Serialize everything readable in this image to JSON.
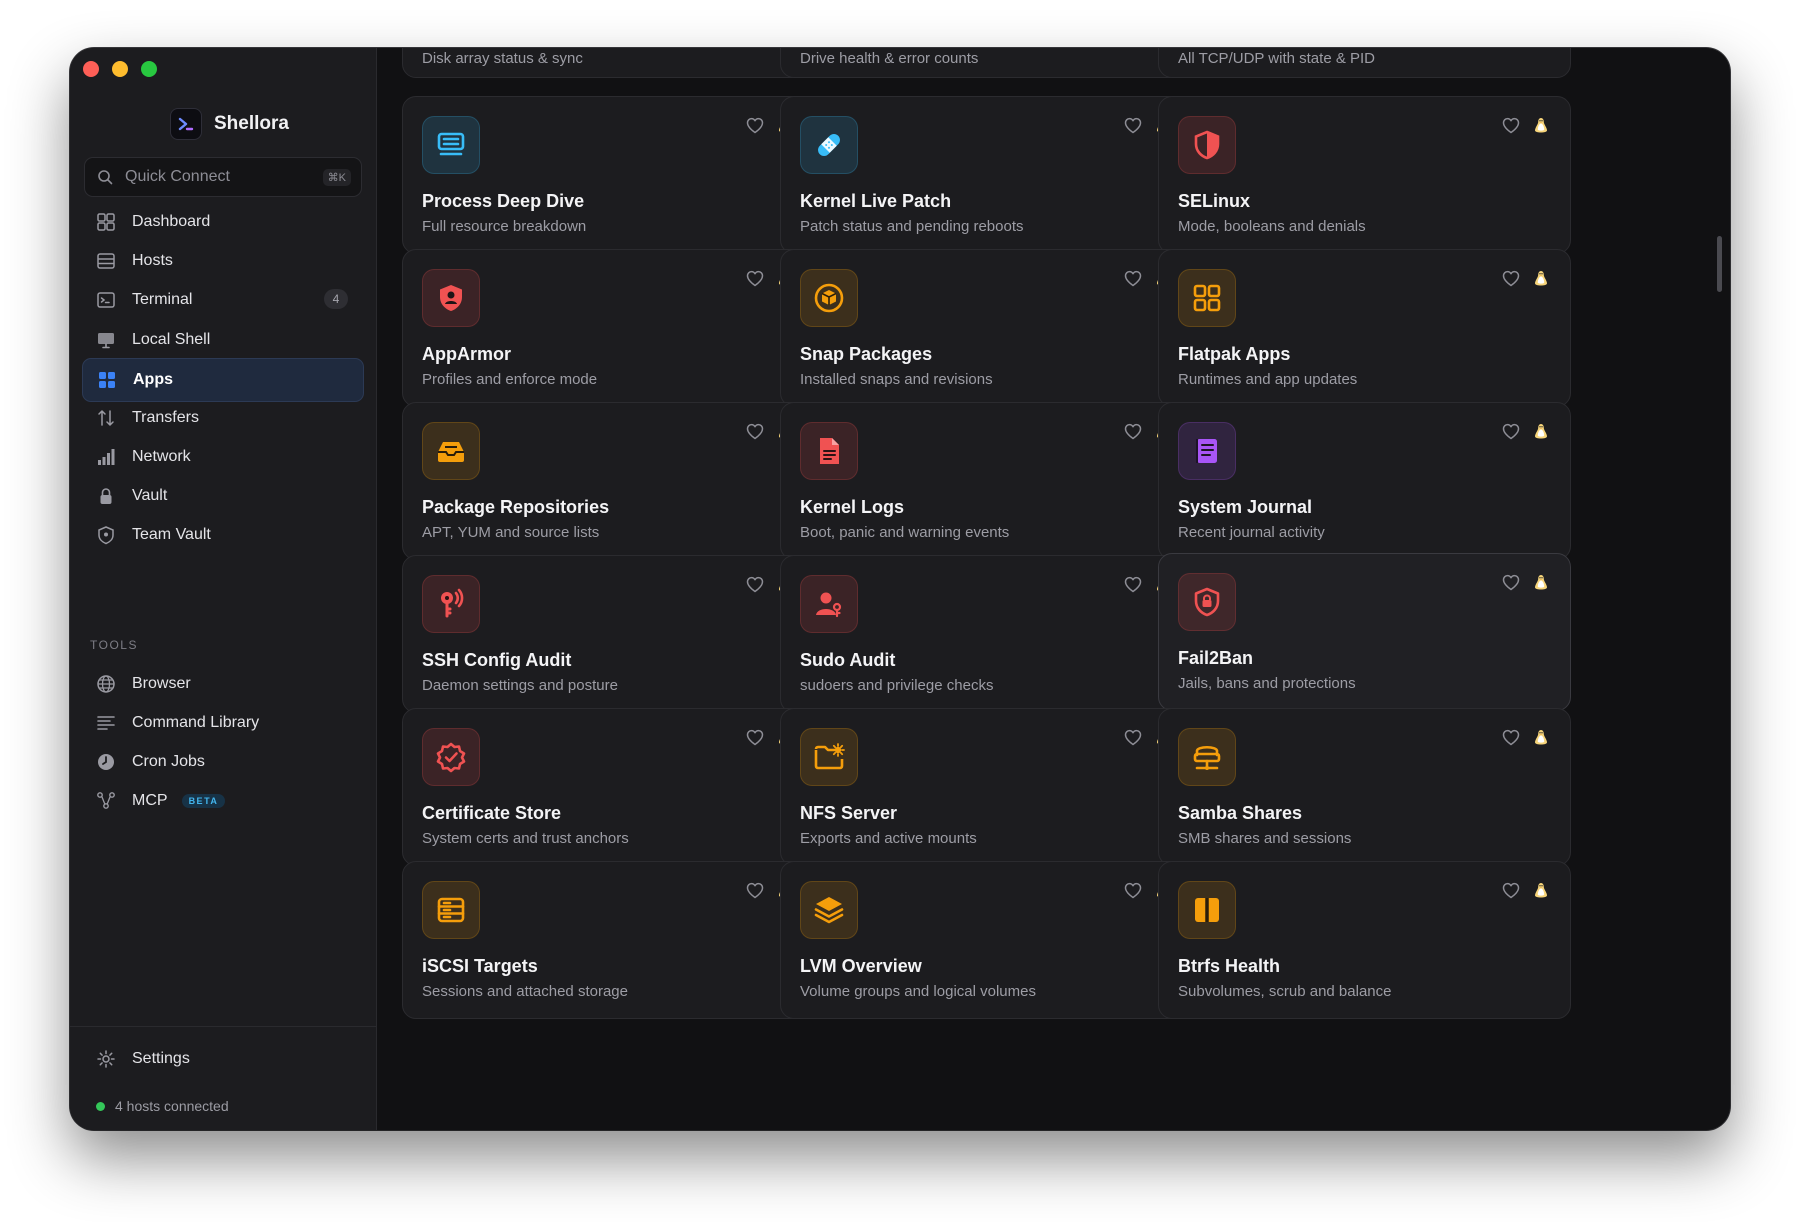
{
  "app": {
    "name": "Shellora"
  },
  "search": {
    "placeholder": "Quick Connect",
    "shortcut": "⌘K"
  },
  "nav": [
    {
      "label": "Dashboard",
      "icon": "dashboard-icon"
    },
    {
      "label": "Hosts",
      "icon": "hosts-icon"
    },
    {
      "label": "Terminal",
      "icon": "terminal-icon",
      "badge": "4"
    },
    {
      "label": "Local Shell",
      "icon": "monitor-icon"
    },
    {
      "label": "Apps",
      "icon": "apps-grid-icon",
      "active": true
    },
    {
      "label": "Transfers",
      "icon": "transfers-icon"
    },
    {
      "label": "Network",
      "icon": "network-bars-icon"
    },
    {
      "label": "Vault",
      "icon": "lock-icon"
    },
    {
      "label": "Team Vault",
      "icon": "shield-icon"
    }
  ],
  "tools": {
    "label": "TOOLS",
    "items": [
      {
        "label": "Browser",
        "icon": "globe-icon"
      },
      {
        "label": "Command Library",
        "icon": "list-icon"
      },
      {
        "label": "Cron Jobs",
        "icon": "clock-icon"
      },
      {
        "label": "MCP",
        "icon": "mcp-nodes-icon",
        "badge": "BETA"
      }
    ]
  },
  "footer": {
    "settings_label": "Settings",
    "status_text": "4 hosts connected",
    "status_color": "#34c759"
  },
  "partial_row": [
    "Disk array status & sync",
    "Drive health & error counts",
    "All TCP/UDP with state & PID"
  ],
  "apps": [
    {
      "title": "Process Deep Dive",
      "desc": "Full resource breakdown",
      "icon": "server-list-icon",
      "color": "#38bdf8"
    },
    {
      "title": "Kernel Live Patch",
      "desc": "Patch status and pending reboots",
      "icon": "bandage-icon",
      "color": "#38bdf8"
    },
    {
      "title": "SELinux",
      "desc": "Mode, booleans and denials",
      "icon": "half-shield-icon",
      "color": "#f05252"
    },
    {
      "title": "AppArmor",
      "desc": "Profiles and enforce mode",
      "icon": "shield-person-icon",
      "color": "#f05252"
    },
    {
      "title": "Snap Packages",
      "desc": "Installed snaps and revisions",
      "icon": "package-box-icon",
      "color": "#f59e0b"
    },
    {
      "title": "Flatpak Apps",
      "desc": "Runtimes and app updates",
      "icon": "four-squares-icon",
      "color": "#f59e0b"
    },
    {
      "title": "Package Repositories",
      "desc": "APT, YUM and source lists",
      "icon": "inbox-tray-icon",
      "color": "#f59e0b"
    },
    {
      "title": "Kernel Logs",
      "desc": "Boot, panic and warning events",
      "icon": "document-icon",
      "color": "#f05252"
    },
    {
      "title": "System Journal",
      "desc": "Recent journal activity",
      "icon": "journal-icon",
      "color": "#a855f7"
    },
    {
      "title": "SSH Config Audit",
      "desc": "Daemon settings and posture",
      "icon": "key-signal-icon",
      "color": "#f05252"
    },
    {
      "title": "Sudo Audit",
      "desc": "sudoers and privilege checks",
      "icon": "user-key-icon",
      "color": "#f05252"
    },
    {
      "title": "Fail2Ban",
      "desc": "Jails, bans and protections",
      "icon": "shield-lock-icon",
      "color": "#f05252"
    },
    {
      "title": "Certificate Store",
      "desc": "System certs and trust anchors",
      "icon": "badge-check-icon",
      "color": "#f05252"
    },
    {
      "title": "NFS Server",
      "desc": "Exports and active mounts",
      "icon": "folder-gear-icon",
      "color": "#f59e0b"
    },
    {
      "title": "Samba Shares",
      "desc": "SMB shares and sessions",
      "icon": "network-drive-icon",
      "color": "#f59e0b"
    },
    {
      "title": "iSCSI Targets",
      "desc": "Sessions and attached storage",
      "icon": "storage-rack-icon",
      "color": "#f59e0b"
    },
    {
      "title": "LVM Overview",
      "desc": "Volume groups and logical volumes",
      "icon": "layers-icon",
      "color": "#f59e0b"
    },
    {
      "title": "Btrfs Health",
      "desc": "Subvolumes, scrub and balance",
      "icon": "split-block-icon",
      "color": "#f59e0b"
    }
  ]
}
